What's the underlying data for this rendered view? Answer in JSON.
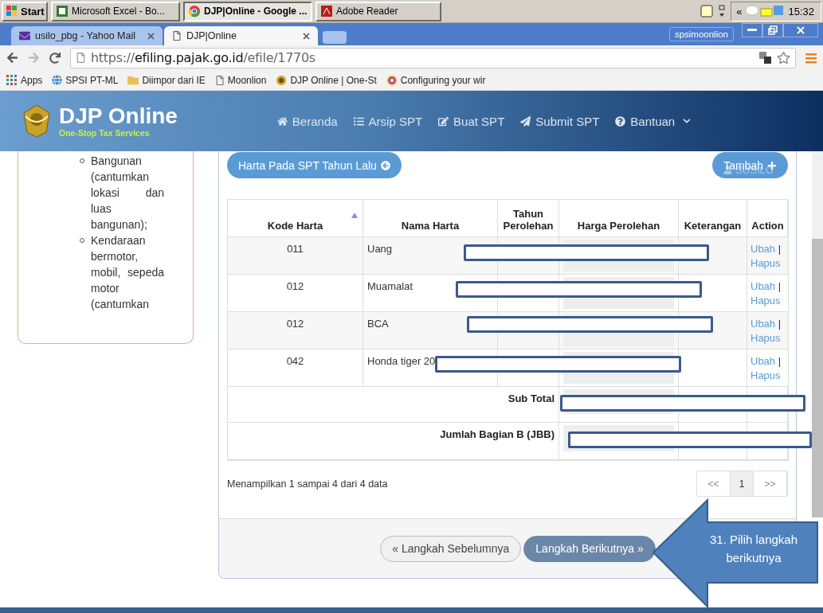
{
  "taskbar": {
    "start": "Start",
    "tasks": [
      {
        "label": "Microsoft Excel - Bo...",
        "kind": "excel",
        "selected": false
      },
      {
        "label": "DJP|Online - Google ...",
        "kind": "chrome",
        "selected": true
      },
      {
        "label": "Adobe Reader",
        "kind": "pdf",
        "selected": false
      }
    ],
    "clock": "15:32",
    "tray_expand": "«"
  },
  "browser": {
    "tabs": [
      {
        "title": "usilo_pbg - Yahoo Mail",
        "kind": "mail",
        "selected": false
      },
      {
        "title": "DJP|Online",
        "kind": "page",
        "selected": true
      }
    ],
    "profile": "spsimoonlion",
    "address": {
      "scheme": "https://",
      "host": "efiling.pajak.go.id",
      "path": "/efile/1770s"
    },
    "bookmarks": [
      {
        "label": "Apps",
        "kind": "apps"
      },
      {
        "label": "SPSI PT-ML",
        "kind": "globe"
      },
      {
        "label": "Diimpor dari IE",
        "kind": "folder"
      },
      {
        "label": "Moonlion",
        "kind": "page"
      },
      {
        "label": "DJP Online | One-St",
        "kind": "emblem"
      },
      {
        "label": "Configuring your wir",
        "kind": "swirl"
      }
    ]
  },
  "site": {
    "logo_title": "DJP Online",
    "logo_subtitle": "One-Stop Tax Services",
    "nav": [
      {
        "label": "Beranda",
        "kind": "home"
      },
      {
        "label": "Arsip SPT",
        "kind": "list"
      },
      {
        "label": "Buat SPT",
        "kind": "edit"
      },
      {
        "label": "Submit SPT",
        "kind": "send"
      },
      {
        "label": "Bantuan",
        "kind": "help",
        "dropdown": true
      }
    ]
  },
  "sidebar": {
    "items": [
      "Bangunan (cantumkan lokasi dan luas bangunan);",
      "Kendaraan bermotor, mobil, sepeda motor (cantumkan"
    ]
  },
  "toolbar": {
    "previous_assets": "Harta Pada SPT Tahun Lalu",
    "add": "Tambah",
    "user_menu": "SUSILO"
  },
  "table": {
    "columns": [
      "Kode Harta",
      "Nama Harta",
      "Tahun Perolehan",
      "Harga Perolehan",
      "Keterangan",
      "Action"
    ],
    "rows": [
      {
        "code": "011",
        "name": "Uang",
        "edit": "Ubah",
        "separator": "|",
        "delete": "Hapus"
      },
      {
        "code": "012",
        "name": "Muamalat",
        "edit": "Ubah",
        "separator": "|",
        "delete": "Hapus"
      },
      {
        "code": "012",
        "name": "BCA",
        "edit": "Ubah",
        "separator": "|",
        "delete": "Hapus"
      },
      {
        "code": "042",
        "name": "Honda tiger 20",
        "edit": "Ubah",
        "separator": "|",
        "delete": "Hapus"
      }
    ],
    "summary": [
      "Sub Total",
      "Jumlah Bagian B (JBB)"
    ]
  },
  "info": "Menampilkan 1 sampai 4 dari 4 data",
  "pagination": [
    {
      "label": "<<",
      "selected": false
    },
    {
      "label": "1",
      "selected": true
    },
    {
      "label": ">>",
      "selected": false
    }
  ],
  "wizard": {
    "previous": "« Langkah Sebelumnya",
    "next": "Langkah Berikutnya »"
  },
  "callout": {
    "text": "31. Pilih langkah berikutnya"
  }
}
